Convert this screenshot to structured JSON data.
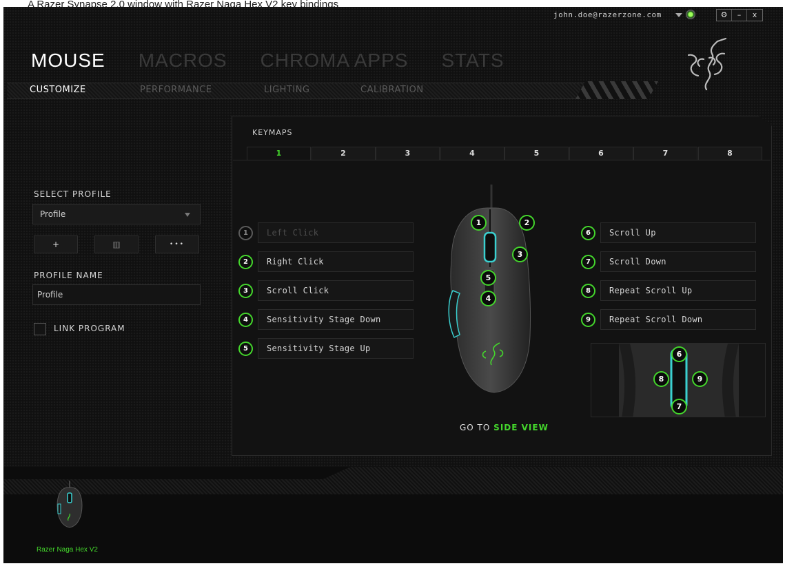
{
  "caption_partial": "A Razer Synapse 2.0 window with Razer Naga Hex V2 key bindings",
  "account": {
    "email": "john.doe@razerzone.com"
  },
  "window_controls": {
    "settings": "⚙",
    "minimize": "–",
    "close": "x"
  },
  "main_tabs": [
    {
      "label": "MOUSE",
      "active": true
    },
    {
      "label": "MACROS",
      "active": false
    },
    {
      "label": "CHROMA APPS",
      "active": false
    },
    {
      "label": "STATS",
      "active": false
    }
  ],
  "sub_tabs": [
    {
      "label": "CUSTOMIZE",
      "active": true
    },
    {
      "label": "PERFORMANCE",
      "active": false
    },
    {
      "label": "LIGHTING",
      "active": false
    },
    {
      "label": "CALIBRATION",
      "active": false
    }
  ],
  "left_panel": {
    "select_profile_label": "SELECT PROFILE",
    "profile_selected": "Profile",
    "add_button": "+",
    "delete_button": "▥",
    "more_button": "•••",
    "profile_name_label": "PROFILE NAME",
    "profile_name_value": "Profile",
    "link_program_label": "LINK PROGRAM",
    "link_program_checked": false
  },
  "keymaps": {
    "title": "KEYMAPS",
    "tabs": [
      "1",
      "2",
      "3",
      "4",
      "5",
      "6",
      "7",
      "8"
    ],
    "active_tab": "1",
    "left_bindings": [
      {
        "num": "1",
        "label": "Left Click",
        "dim": true
      },
      {
        "num": "2",
        "label": "Right Click",
        "dim": false
      },
      {
        "num": "3",
        "label": "Scroll Click",
        "dim": false
      },
      {
        "num": "4",
        "label": "Sensitivity Stage Down",
        "dim": false
      },
      {
        "num": "5",
        "label": "Sensitivity Stage Up",
        "dim": false
      }
    ],
    "right_bindings": [
      {
        "num": "6",
        "label": "Scroll Up"
      },
      {
        "num": "7",
        "label": "Scroll Down"
      },
      {
        "num": "8",
        "label": "Repeat Scroll Up"
      },
      {
        "num": "9",
        "label": "Repeat Scroll Down"
      }
    ],
    "mouse_markers": [
      "1",
      "2",
      "3",
      "4",
      "5"
    ],
    "zoom_markers": [
      "6",
      "7",
      "8",
      "9"
    ],
    "goto_prefix": "GO TO",
    "goto_link": "SIDE VIEW"
  },
  "device": {
    "name": "Razer Naga Hex V2"
  },
  "colors": {
    "accent": "#44d62c",
    "background": "#101010",
    "panel_border": "#2a2a2a"
  },
  "icons": [
    "razer-logo-icon",
    "settings-gear-icon",
    "minimize-icon",
    "close-icon",
    "dropdown-caret-icon",
    "status-indicator-icon"
  ]
}
